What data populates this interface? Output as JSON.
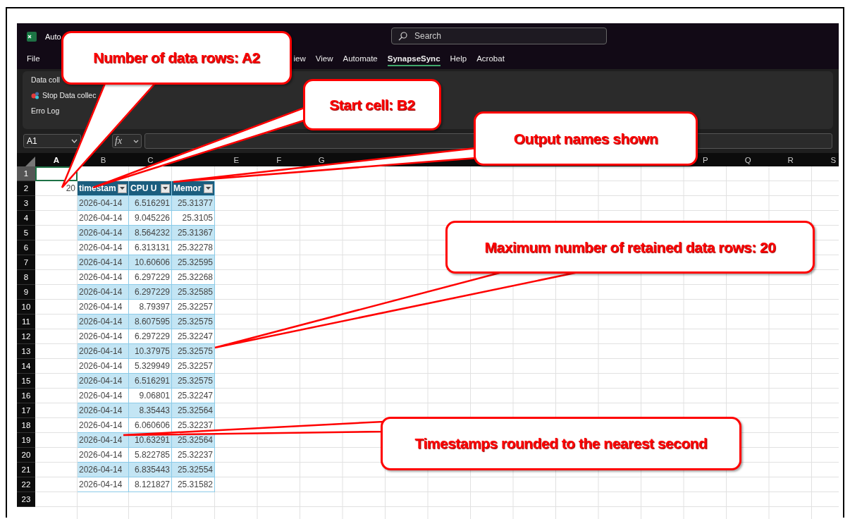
{
  "window": {
    "title": "Auto"
  },
  "search": {
    "placeholder": "Search"
  },
  "menu_tabs": [
    {
      "label": "File",
      "selected": false
    },
    {
      "label": "iew",
      "selected": false
    },
    {
      "label": "View",
      "selected": false
    },
    {
      "label": "Automate",
      "selected": false
    },
    {
      "label": "SynapseSync",
      "selected": true
    },
    {
      "label": "Help",
      "selected": false
    },
    {
      "label": "Acrobat",
      "selected": false
    }
  ],
  "ribbon": {
    "items": [
      {
        "label": "Data coll",
        "kind": "text"
      },
      {
        "label": "Stop Data collec",
        "kind": "stop"
      },
      {
        "label": "Erro Log",
        "kind": "text"
      }
    ]
  },
  "formula_bar": {
    "name_box": "A1",
    "fx": "fx"
  },
  "sheet": {
    "columns": [
      {
        "label": "A",
        "selected": true
      },
      {
        "label": "B",
        "selected": false
      },
      {
        "label": "C",
        "selected": false
      },
      null,
      {
        "label": "E",
        "selected": false
      },
      {
        "label": "F",
        "selected": false
      },
      {
        "label": "G",
        "selected": false
      },
      null,
      null,
      null,
      null,
      null,
      null,
      null,
      null,
      {
        "label": "P",
        "selected": false
      },
      {
        "label": "Q",
        "selected": false
      },
      {
        "label": "R",
        "selected": false
      },
      {
        "label": "S",
        "selected": false
      }
    ],
    "rows": [
      {
        "number": "1",
        "selected": true,
        "kind": "plain",
        "cells": []
      },
      {
        "number": "2",
        "selected": false,
        "kind": "table-header",
        "cells": [
          "20",
          "timestam",
          "CPU U",
          "Memor"
        ]
      },
      {
        "number": "3",
        "selected": false,
        "kind": "table-row",
        "cells": [
          null,
          "2026-04-14",
          "6.516291",
          "25.31377"
        ]
      },
      {
        "number": "4",
        "selected": false,
        "kind": "table-row",
        "cells": [
          null,
          "2026-04-14",
          "9.045226",
          "25.3105"
        ]
      },
      {
        "number": "5",
        "selected": false,
        "kind": "table-row",
        "cells": [
          null,
          "2026-04-14",
          "8.564232",
          "25.31367"
        ]
      },
      {
        "number": "6",
        "selected": false,
        "kind": "table-row",
        "cells": [
          null,
          "2026-04-14",
          "6.313131",
          "25.32278"
        ]
      },
      {
        "number": "7",
        "selected": false,
        "kind": "table-row",
        "cells": [
          null,
          "2026-04-14",
          "10.60606",
          "25.32595"
        ]
      },
      {
        "number": "8",
        "selected": false,
        "kind": "table-row",
        "cells": [
          null,
          "2026-04-14",
          "6.297229",
          "25.32268"
        ]
      },
      {
        "number": "9",
        "selected": false,
        "kind": "table-row",
        "cells": [
          null,
          "2026-04-14",
          "6.297229",
          "25.32585"
        ]
      },
      {
        "number": "10",
        "selected": false,
        "kind": "table-row",
        "cells": [
          null,
          "2026-04-14",
          "8.79397",
          "25.32257"
        ]
      },
      {
        "number": "11",
        "selected": false,
        "kind": "table-row",
        "cells": [
          null,
          "2026-04-14",
          "8.607595",
          "25.32575"
        ]
      },
      {
        "number": "12",
        "selected": false,
        "kind": "table-row",
        "cells": [
          null,
          "2026-04-14",
          "6.297229",
          "25.32247"
        ]
      },
      {
        "number": "13",
        "selected": false,
        "kind": "table-row",
        "cells": [
          null,
          "2026-04-14",
          "10.37975",
          "25.32575"
        ]
      },
      {
        "number": "14",
        "selected": false,
        "kind": "table-row",
        "cells": [
          null,
          "2026-04-14",
          "5.329949",
          "25.32257"
        ]
      },
      {
        "number": "15",
        "selected": false,
        "kind": "table-row",
        "cells": [
          null,
          "2026-04-14",
          "6.516291",
          "25.32575"
        ]
      },
      {
        "number": "16",
        "selected": false,
        "kind": "table-row",
        "cells": [
          null,
          "2026-04-14",
          "9.06801",
          "25.32247"
        ]
      },
      {
        "number": "17",
        "selected": false,
        "kind": "table-row",
        "cells": [
          null,
          "2026-04-14",
          "8.35443",
          "25.32564"
        ]
      },
      {
        "number": "18",
        "selected": false,
        "kind": "table-row",
        "cells": [
          null,
          "2026-04-14",
          "6.060606",
          "25.32237"
        ]
      },
      {
        "number": "19",
        "selected": false,
        "kind": "table-row",
        "cells": [
          null,
          "2026-04-14",
          "10.63291",
          "25.32564"
        ]
      },
      {
        "number": "20",
        "selected": false,
        "kind": "table-row",
        "cells": [
          null,
          "2026-04-14",
          "5.822785",
          "25.32237"
        ]
      },
      {
        "number": "21",
        "selected": false,
        "kind": "table-row",
        "cells": [
          null,
          "2026-04-14",
          "6.835443",
          "25.32554"
        ]
      },
      {
        "number": "22",
        "selected": false,
        "kind": "table-row",
        "cells": [
          null,
          "2026-04-14",
          "8.121827",
          "25.31582"
        ]
      },
      {
        "number": "23",
        "selected": false,
        "kind": "plain",
        "cells": []
      }
    ]
  },
  "callouts": [
    {
      "text": "Number of data rows: A2"
    },
    {
      "text": "Start cell: B2"
    },
    {
      "text": "Output names shown"
    },
    {
      "text": "Maximum number of retained data rows: 20"
    },
    {
      "text": "Timestamps rounded to the nearest second"
    }
  ]
}
